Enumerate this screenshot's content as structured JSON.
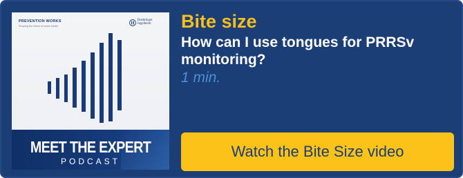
{
  "colors": {
    "card_background": "#1b3e76",
    "heading": "#f5bf1d",
    "question": "#ffffff",
    "duration": "#4d8ed6",
    "button_background": "#fbc21a",
    "button_text": "#1b3e76",
    "cover_band": "#0f2f66"
  },
  "cover": {
    "brand": "PREVENTION WORKS",
    "brand_tagline": "Shaping the future of swine health",
    "partner_logo_text": "Boehringer Ingelheim",
    "partner_logo_icon": "boehringer-ingelheim-logo-icon",
    "graphic_icon": "sound-wave-bars-icon",
    "title": "MEET THE EXPERT",
    "subtitle": "PODCAST"
  },
  "content": {
    "heading": "Bite size",
    "question": "How can I use tongues for PRRSv monitoring?",
    "duration": "1 min."
  },
  "cta": {
    "label": "Watch the Bite Size video"
  }
}
